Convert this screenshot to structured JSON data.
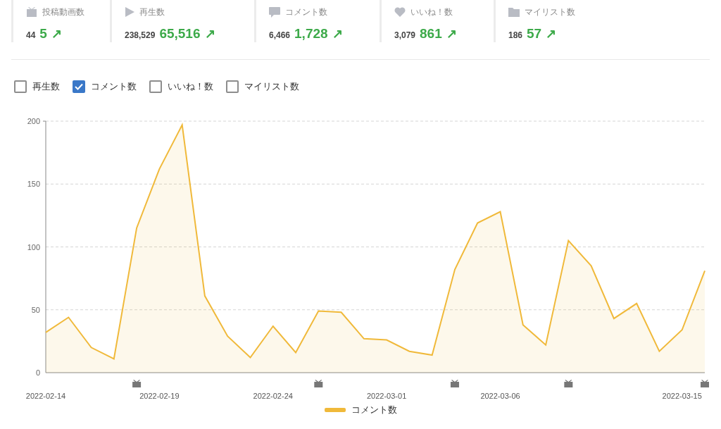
{
  "stats": [
    {
      "label": "投稿動画数",
      "total": "44",
      "increase": "5",
      "trend": "↗"
    },
    {
      "label": "再生数",
      "total": "238,529",
      "increase": "65,516",
      "trend": "↗"
    },
    {
      "label": "コメント数",
      "total": "6,466",
      "increase": "1,728",
      "trend": "↗"
    },
    {
      "label": "いいね！数",
      "total": "3,079",
      "increase": "861",
      "trend": "↗"
    },
    {
      "label": "マイリスト数",
      "total": "186",
      "increase": "57",
      "trend": "↗"
    }
  ],
  "series_toggles": [
    {
      "label": "再生数",
      "checked": false
    },
    {
      "label": "コメント数",
      "checked": true
    },
    {
      "label": "いいね！数",
      "checked": false
    },
    {
      "label": "マイリスト数",
      "checked": false
    }
  ],
  "chart": {
    "chart_data": {
      "type": "area",
      "categories": [
        "2022-02-14",
        null,
        null,
        null,
        null,
        "2022-02-19",
        null,
        null,
        null,
        null,
        "2022-02-24",
        null,
        null,
        null,
        null,
        "2022-03-01",
        null,
        null,
        null,
        null,
        "2022-03-06",
        null,
        null,
        null,
        null,
        null,
        null,
        null,
        "2022-03-15",
        null
      ],
      "grid": true,
      "series": [
        {
          "name": "コメント数",
          "color": "#f0b93a",
          "values": [
            32,
            44,
            20,
            11,
            115,
            162,
            197,
            61,
            29,
            12,
            37,
            16,
            49,
            48,
            27,
            26,
            17,
            14,
            82,
            119,
            128,
            38,
            22,
            105,
            85,
            43,
            55,
            17,
            34,
            81
          ]
        }
      ],
      "ylim": [
        0,
        200
      ],
      "yticks": [
        0,
        50,
        100,
        150,
        200
      ]
    }
  }
}
